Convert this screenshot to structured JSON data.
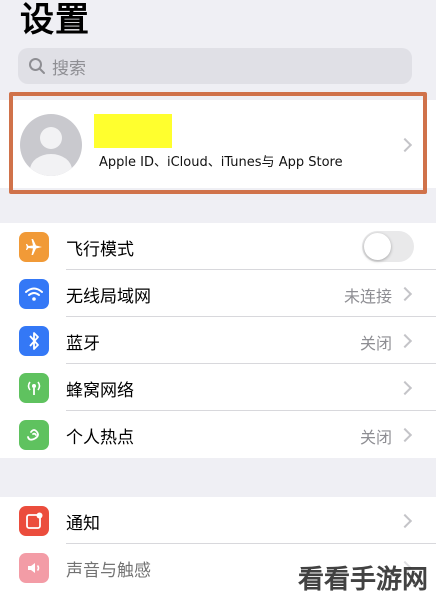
{
  "header": {
    "title": "设置"
  },
  "search": {
    "placeholder": "搜索"
  },
  "account": {
    "subtitle": "Apple ID、iCloud、iTunes与 App Store"
  },
  "group1": [
    {
      "label": "飞行模式",
      "value": "",
      "color": "#f19a37",
      "icon": "airplane-icon",
      "control": "toggle",
      "toggle_on": false
    },
    {
      "label": "无线局域网",
      "value": "未连接",
      "color": "#3478f6",
      "icon": "wifi-icon",
      "control": "chevron"
    },
    {
      "label": "蓝牙",
      "value": "关闭",
      "color": "#3478f6",
      "icon": "bluetooth-icon",
      "control": "chevron"
    },
    {
      "label": "蜂窝网络",
      "value": "",
      "color": "#5fc25f",
      "icon": "cellular-icon",
      "control": "chevron"
    },
    {
      "label": "个人热点",
      "value": "关闭",
      "color": "#5fc25f",
      "icon": "hotspot-icon",
      "control": "chevron"
    }
  ],
  "group2": [
    {
      "label": "通知",
      "value": "",
      "color": "#eb4d3d",
      "icon": "notifications-icon",
      "control": "chevron"
    },
    {
      "label": "声音与触感",
      "value": "",
      "color": "#eb4d5f",
      "icon": "sound-icon",
      "control": "chevron"
    }
  ],
  "watermark": "看看手游网"
}
